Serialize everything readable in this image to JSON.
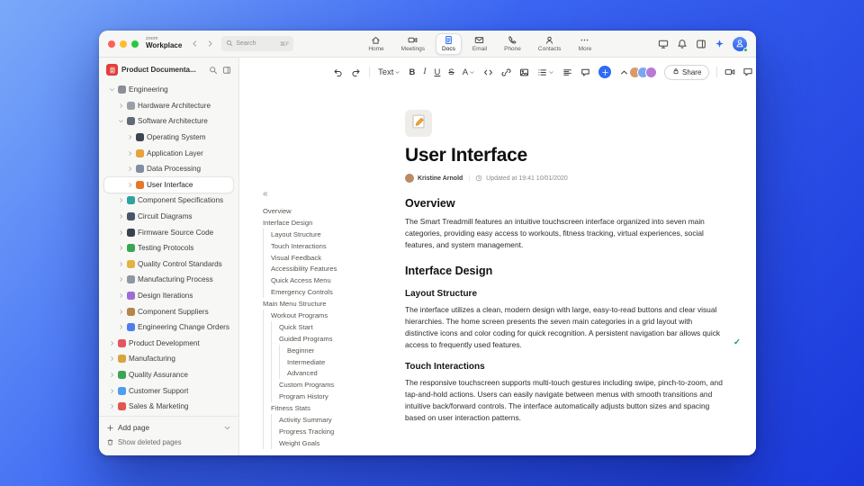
{
  "colors": {
    "accent": "#2e6bf6",
    "check": "#12a150"
  },
  "titlebar": {
    "logo_top": "zoom",
    "logo_bottom": "Workplace",
    "search_label": "Search",
    "search_shortcut": "⌘F",
    "tabs": [
      {
        "label": "Home",
        "icon": "home",
        "active": false
      },
      {
        "label": "Meetings",
        "icon": "video",
        "active": false
      },
      {
        "label": "Docs",
        "icon": "docs",
        "active": true
      },
      {
        "label": "Email",
        "icon": "email",
        "active": false
      },
      {
        "label": "Phone",
        "icon": "phone",
        "active": false
      },
      {
        "label": "Contacts",
        "icon": "contacts",
        "active": false
      },
      {
        "label": "More",
        "icon": "more",
        "active": false
      }
    ]
  },
  "sidebar": {
    "workspace_name": "Product Documenta...",
    "tree": [
      {
        "label": "Engineering",
        "level": 0,
        "expanded": true,
        "icon": "gear",
        "color": "#8a8f98"
      },
      {
        "label": "Hardware Architecture",
        "level": 1,
        "expanded": false,
        "icon": "chip",
        "color": "#9aa0a6"
      },
      {
        "label": "Software Architecture",
        "level": 1,
        "expanded": true,
        "icon": "disk",
        "color": "#5f6b7a"
      },
      {
        "label": "Operating System",
        "level": 2,
        "expanded": false,
        "icon": "terminal",
        "color": "#3d4551"
      },
      {
        "label": "Application Layer",
        "level": 2,
        "expanded": false,
        "icon": "layers",
        "color": "#e8a23d"
      },
      {
        "label": "Data Processing",
        "level": 2,
        "expanded": false,
        "icon": "chart",
        "color": "#7f8ea3"
      },
      {
        "label": "User Interface",
        "level": 2,
        "expanded": false,
        "icon": "screen",
        "color": "#e8762d",
        "selected": true
      },
      {
        "label": "Component Specifications",
        "level": 1,
        "expanded": false,
        "icon": "clipboard",
        "color": "#2fa3a0"
      },
      {
        "label": "Circuit Diagrams",
        "level": 1,
        "expanded": false,
        "icon": "circuit",
        "color": "#4a5568"
      },
      {
        "label": "Firmware Source Code",
        "level": 1,
        "expanded": false,
        "icon": "code-file",
        "color": "#374151"
      },
      {
        "label": "Testing Protocols",
        "level": 1,
        "expanded": false,
        "icon": "flask",
        "color": "#3aa655"
      },
      {
        "label": "Quality Control Standards",
        "level": 1,
        "expanded": false,
        "icon": "check-badge",
        "color": "#e3b341"
      },
      {
        "label": "Manufacturing Process",
        "level": 1,
        "expanded": false,
        "icon": "factory",
        "color": "#8c97a5"
      },
      {
        "label": "Design Iterations",
        "level": 1,
        "expanded": false,
        "icon": "palette",
        "color": "#a06cd5"
      },
      {
        "label": "Component Suppliers",
        "level": 1,
        "expanded": false,
        "icon": "box",
        "color": "#b5854a"
      },
      {
        "label": "Engineering Change Orders",
        "level": 1,
        "expanded": false,
        "icon": "doc-change",
        "color": "#4f7df0"
      },
      {
        "label": "Product Development",
        "level": 0,
        "expanded": false,
        "icon": "rocket",
        "color": "#e25563"
      },
      {
        "label": "Manufacturing",
        "level": 0,
        "expanded": false,
        "icon": "gear-yellow",
        "color": "#d9a441"
      },
      {
        "label": "Quality Assurance",
        "level": 0,
        "expanded": false,
        "icon": "shield",
        "color": "#3aa655"
      },
      {
        "label": "Customer Support",
        "level": 0,
        "expanded": false,
        "icon": "chat",
        "color": "#4f9df0"
      },
      {
        "label": "Sales & Marketing",
        "level": 0,
        "expanded": false,
        "icon": "trend",
        "color": "#e2574d"
      }
    ],
    "add_page_label": "Add page",
    "show_deleted_label": "Show deleted pages"
  },
  "outline": {
    "collapse_glyph": "«",
    "items": [
      {
        "label": "Overview",
        "level": 0
      },
      {
        "label": "Interface Design",
        "level": 0
      },
      {
        "label": "Layout Structure",
        "level": 1
      },
      {
        "label": "Touch Interactions",
        "level": 1
      },
      {
        "label": "Visual Feedback",
        "level": 1
      },
      {
        "label": "Accessibility Features",
        "level": 1
      },
      {
        "label": "Quick Access Menu",
        "level": 1
      },
      {
        "label": "Emergency Controls",
        "level": 1
      },
      {
        "label": "Main Menu Structure",
        "level": 0
      },
      {
        "label": "Workout Programs",
        "level": 1
      },
      {
        "label": "Quick Start",
        "level": 2
      },
      {
        "label": "Guided Programs",
        "level": 2
      },
      {
        "label": "Beginner",
        "level": 3
      },
      {
        "label": "Intermediate",
        "level": 3
      },
      {
        "label": "Advanced",
        "level": 3
      },
      {
        "label": "Custom Programs",
        "level": 2
      },
      {
        "label": "Program History",
        "level": 2
      },
      {
        "label": "Fitness Stats",
        "level": 1
      },
      {
        "label": "Activity Summary",
        "level": 2
      },
      {
        "label": "Progress Tracking",
        "level": 2
      },
      {
        "label": "Weight Goals",
        "level": 2
      }
    ]
  },
  "toolbar": {
    "items": [
      {
        "name": "undo",
        "icon": "undo"
      },
      {
        "name": "redo",
        "icon": "redo"
      },
      {
        "type": "divider"
      },
      {
        "name": "text-style",
        "label": "Text",
        "chevron": true
      },
      {
        "name": "bold",
        "label": "B"
      },
      {
        "name": "italic",
        "label": "I"
      },
      {
        "name": "underline",
        "label": "U"
      },
      {
        "name": "strikethrough",
        "label": "S"
      },
      {
        "name": "text-color",
        "label": "A",
        "chevron": true
      },
      {
        "name": "code",
        "icon": "code"
      },
      {
        "name": "link",
        "icon": "link"
      },
      {
        "name": "image",
        "icon": "image"
      },
      {
        "name": "bullet-list",
        "icon": "list",
        "chevron": true
      },
      {
        "name": "align",
        "icon": "align"
      },
      {
        "name": "comment",
        "icon": "comment"
      },
      {
        "name": "insert",
        "icon": "plus",
        "accent": true
      },
      {
        "name": "collapse-toolbar",
        "icon": "chevU"
      }
    ],
    "share_label": "Share",
    "avatars": [
      "#d99a6c",
      "#7aa7f0",
      "#b77bd4"
    ]
  },
  "doc": {
    "title": "User Interface",
    "author": "Kristine Arnold",
    "updated": "Updated at 19:41 10/01/2020",
    "sections": [
      {
        "type": "h2",
        "text": "Overview"
      },
      {
        "type": "p",
        "text": "The Smart Treadmill features an intuitive touchscreen interface organized into seven main categories, providing easy access to workouts, fitness tracking, virtual experiences, social features, and system management."
      },
      {
        "type": "h2",
        "text": "Interface Design"
      },
      {
        "type": "h3",
        "text": "Layout Structure"
      },
      {
        "type": "p",
        "text": "The interface utilizes a clean, modern design with large, easy-to-read buttons and clear visual hierarchies. The home screen presents the seven main categories in a grid layout with distinctive icons and color coding for quick recognition. A persistent navigation bar allows quick access to frequently used features.",
        "check": true
      },
      {
        "type": "h3",
        "text": "Touch Interactions"
      },
      {
        "type": "p",
        "text": "The responsive touchscreen supports multi-touch gestures including swipe, pinch-to-zoom, and tap-and-hold actions. Users can easily navigate between menus with smooth transitions and intuitive back/forward controls. The interface automatically adjusts button sizes and spacing based on user interaction patterns."
      }
    ]
  }
}
